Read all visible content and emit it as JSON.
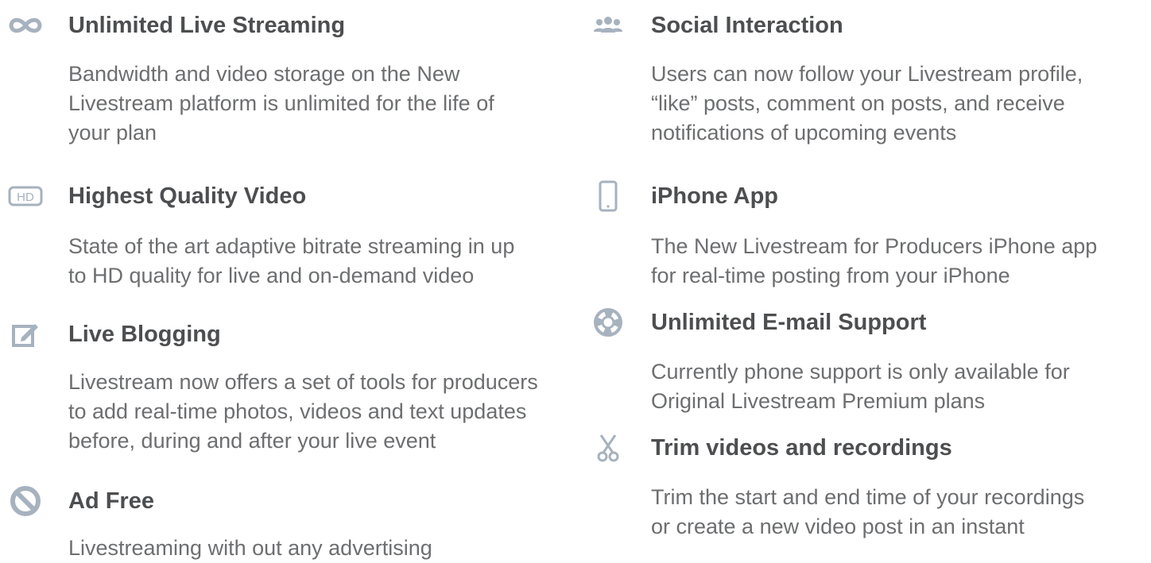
{
  "colors": {
    "title": "#4d4e50",
    "body": "#6d6e70",
    "icon": "#a7b2bf"
  },
  "features": [
    {
      "icon": "infinity-icon",
      "title": "Unlimited Live Streaming",
      "lines": [
        "Bandwidth and video storage on the New",
        "Livestream platform is unlimited for the life of",
        "your plan"
      ]
    },
    {
      "icon": "hd-icon",
      "title": "Highest Quality Video",
      "lines": [
        "State of the art adaptive bitrate streaming in up",
        "to HD quality for live and on-demand video"
      ]
    },
    {
      "icon": "edit-icon",
      "title": "Live Blogging",
      "lines": [
        "Livestream now offers a set of tools for producers",
        "to add real-time photos, videos and text updates",
        "before, during and after your live event"
      ]
    },
    {
      "icon": "block-icon",
      "title": "Ad Free",
      "lines": [
        "Livestreaming with out any advertising"
      ]
    },
    {
      "icon": "users-icon",
      "title": "Social Interaction",
      "lines": [
        "Users can now follow your Livestream profile,",
        "“like” posts, comment on posts, and receive",
        "notifications of upcoming events"
      ]
    },
    {
      "icon": "phone-icon",
      "title": "iPhone App",
      "lines": [
        "The New Livestream for Producers iPhone app",
        "for real-time posting from your iPhone"
      ]
    },
    {
      "icon": "lifebuoy-icon",
      "title": "Unlimited E-mail Support",
      "lines": [
        "Currently phone support is only available for",
        "Original Livestream Premium plans"
      ]
    },
    {
      "icon": "scissors-icon",
      "title": "Trim videos and recordings",
      "lines": [
        "Trim the start and end time of your recordings",
        "or create a new video post in an instant"
      ]
    }
  ]
}
